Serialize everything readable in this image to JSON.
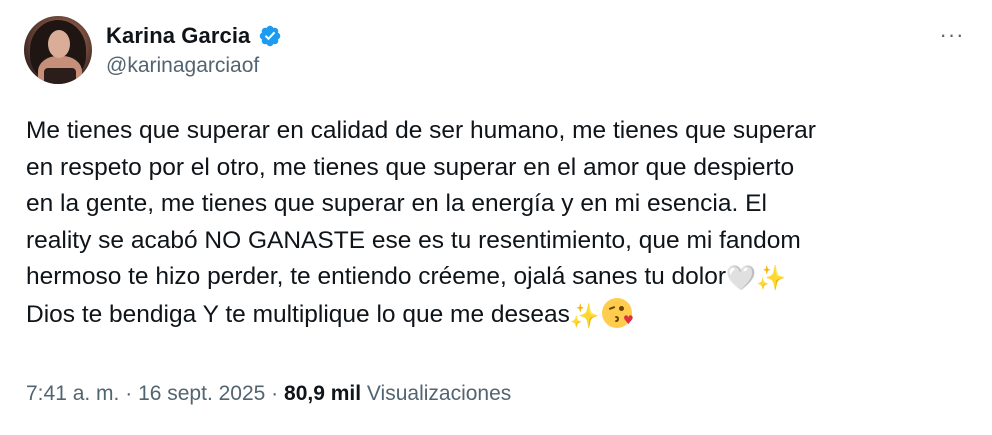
{
  "author": {
    "name": "Karina Garcia",
    "handle": "@karinagarciaof",
    "verified": true,
    "verified_color": "#1d9bf0"
  },
  "more_label": "···",
  "tweet": {
    "lines": [
      "Me tienes que superar en calidad de ser humano, me tienes que superar",
      "en respeto por el otro, me tienes que superar en el amor que despierto",
      "en la gente, me tienes que superar en la energía y en mi esencia. El",
      "reality se acabó NO GANASTE ese es tu resentimiento, que mi fandom",
      "hermoso te hizo perder, te entiendo créeme, ojalá sanes tu dolor",
      "Dios te bendiga Y te multiplique lo que me deseas"
    ],
    "emojis": {
      "white_heart": "🤍",
      "sparkles": "✨",
      "face_blowing_kiss": "😘"
    }
  },
  "meta": {
    "time": "7:41 a. m.",
    "sep1": " · ",
    "date": "16 sept. 2025",
    "sep2": " · ",
    "views_count": "80,9 mil",
    "views_label": "Visualizaciones"
  },
  "colors": {
    "text_primary": "#0f1419",
    "text_secondary": "#536471",
    "background": "#ffffff"
  }
}
